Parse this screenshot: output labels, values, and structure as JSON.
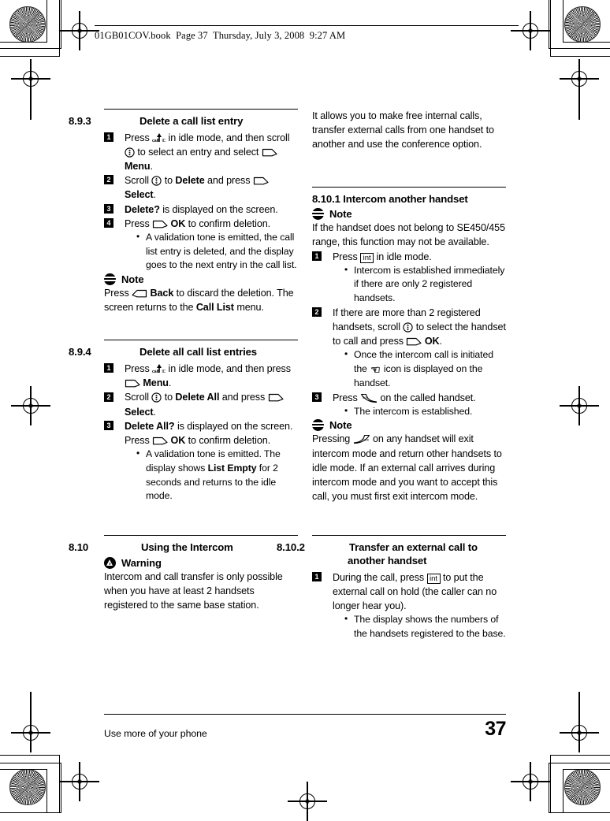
{
  "book_header": "01GB01COV.book  Page 37  Thursday, July 3, 2008  9:27 AM",
  "left_column": {
    "section_893": {
      "number": "8.9.3",
      "title": "Delete a call list entry",
      "steps": [
        {
          "n": "1"
        },
        {
          "n": "2"
        },
        {
          "n": "3"
        },
        {
          "n": "4"
        }
      ],
      "step1_a": "Press",
      "step1_b": "in idle mode, and then scroll",
      "step1_c": "to select an entry and select",
      "step1_menu": "Menu",
      "step1_d": ".",
      "step2_a": "Scroll",
      "step2_b": "to",
      "step2_delete": "Delete",
      "step2_c": "and press",
      "step2_select": "Select",
      "step2_d": ".",
      "step3_q": "Delete?",
      "step3_rest": "is displayed on the screen.",
      "step4_a": "Press",
      "step4_ok": "OK",
      "step4_b": "to confirm deletion.",
      "step4_bullet": "A validation tone is emitted, the call list entry is deleted, and the display goes to the next entry in the call list.",
      "note_label": "Note",
      "note_a": "Press",
      "note_back": "Back",
      "note_b": "to discard the deletion. The screen returns to the",
      "note_calllist": "Call List",
      "note_c": "menu."
    },
    "section_894": {
      "number": "8.9.4",
      "title": "Delete all call list entries",
      "step1_a": "Press",
      "step1_b": "in idle mode, and then press",
      "step1_menu": "Menu",
      "step1_c": ".",
      "step2_a": "Scroll",
      "step2_b": "to",
      "step2_deleteall": "Delete All",
      "step2_c": "and press",
      "step2_select": "Select",
      "step2_d": ".",
      "step3_q": "Delete All?",
      "step3_a": "is displayed on the screen. Press",
      "step3_ok": "OK",
      "step3_b": "to confirm deletion.",
      "step3_bullet_a": "A validation tone is emitted. The display shows",
      "step3_bullet_bold": "List Empty",
      "step3_bullet_b": "for 2 seconds and returns to the idle mode."
    },
    "section_810": {
      "number": "8.10",
      "title": "Using the Intercom",
      "warning_label": "Warning",
      "body": "Intercom and call transfer is only possible when you have at least 2 handsets registered to the same base station."
    }
  },
  "right_column": {
    "intro": "It allows you to make free internal calls, transfer external calls from one handset to another and use the conference option.",
    "section_8101": {
      "number": "8.10.1",
      "title": "Intercom another handset",
      "note_label": "Note",
      "note_body": "If the handset does not belong to SE450/455 range, this function may not be available.",
      "step1_a": "Press",
      "step1_int": "int",
      "step1_b": "in idle mode.",
      "step1_bullet": "Intercom is established immediately if there are only 2 registered handsets.",
      "step2_a": "If there are more than 2 registered handsets, scroll",
      "step2_b": "to select the handset to call and press",
      "step2_ok": "OK",
      "step2_c": ".",
      "step2_bullet_a": "Once the intercom call is initiated the",
      "step2_bullet_b": "icon is displayed on the handset.",
      "step3_a": "Press",
      "step3_b": "on the called handset.",
      "step3_bullet": "The intercom is established.",
      "note2_label": "Note",
      "note2_a": "Pressing",
      "note2_b": "on any handset will exit intercom mode and return other handsets to idle mode. If an external call arrives during intercom mode and you want to accept this call, you must first exit intercom mode."
    },
    "section_8102": {
      "number": "8.10.2",
      "title_line1": "Transfer an external call to",
      "title_line2": "another handset",
      "step1_a": "During the call, press",
      "step1_int": "int",
      "step1_b": "to put the external call on hold (the caller can no longer hear you).",
      "step1_bullet": "The display shows the numbers of the handsets registered to the base."
    }
  },
  "footer": {
    "text": "Use more of your phone",
    "page_number": "37"
  },
  "icons": {
    "note": "note-icon",
    "warning": "warning-icon",
    "softkey": "softkey-icon",
    "softkey_back": "softkey-back-icon",
    "scroll": "scroll-key-icon",
    "callid": "callid-key-icon",
    "int": "int-key-icon",
    "talk": "talk-key-icon",
    "end": "end-key-icon",
    "intercom": "intercom-icon"
  }
}
